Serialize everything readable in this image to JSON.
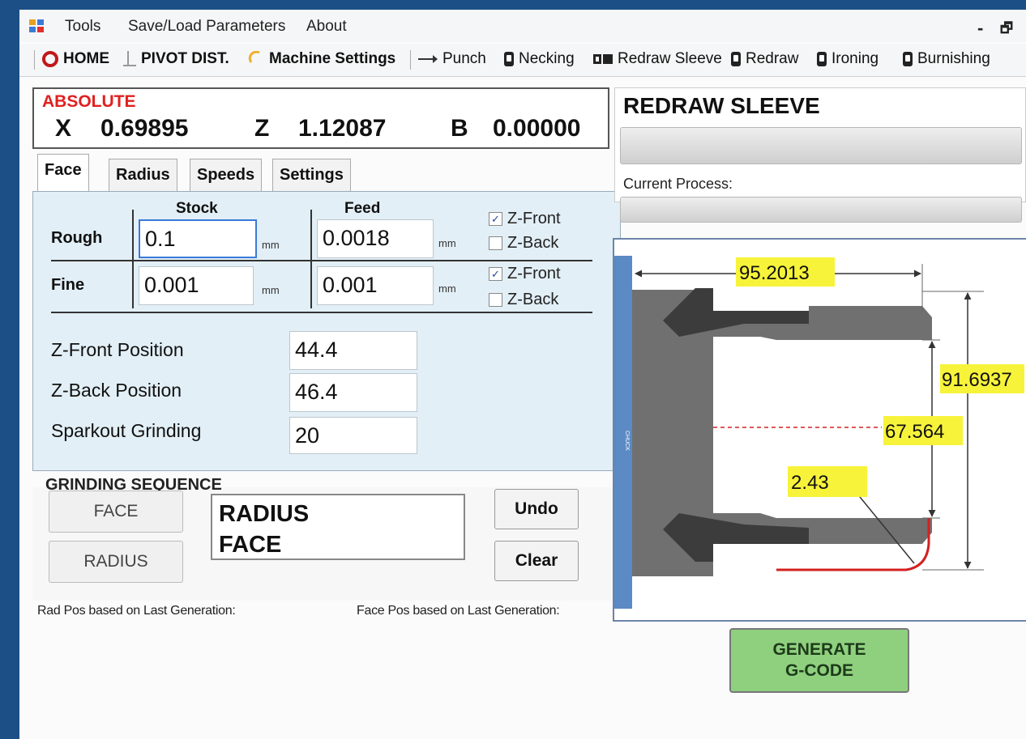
{
  "menu": {
    "items": [
      "Tools",
      "Save/Load Parameters",
      "About"
    ],
    "minimize": "-",
    "restore": "🗗"
  },
  "toolbar": {
    "home": "HOME",
    "pivot": "PIVOT DIST.",
    "machine": "Machine Settings",
    "punch": "Punch",
    "necking": "Necking",
    "redraw_sleeve": "Redraw Sleeve",
    "redraw": "Redraw",
    "ironing": "Ironing",
    "burnishing": "Burnishing"
  },
  "position": {
    "label": "ABSOLUTE",
    "x_label": "X",
    "x_value": "0.69895",
    "z_label": "Z",
    "z_value": "1.12087",
    "b_label": "B",
    "b_value": "0.00000"
  },
  "tabs": [
    "Face",
    "Radius",
    "Speeds",
    "Settings"
  ],
  "face": {
    "stock_header": "Stock",
    "feed_header": "Feed",
    "rough_label": "Rough",
    "fine_label": "Fine",
    "rough_stock": "0.1",
    "rough_feed": "0.0018",
    "fine_stock": "0.001",
    "fine_feed": "0.001",
    "unit": "mm",
    "zfront_label": "Z-Front",
    "zback_label": "Z-Back",
    "rough_zfront_checked": true,
    "rough_zback_checked": false,
    "fine_zfront_checked": true,
    "fine_zback_checked": false,
    "zfront_pos_label": "Z-Front Position",
    "zfront_pos": "44.4",
    "zback_pos_label": "Z-Back Position",
    "zback_pos": "46.4",
    "sparkout_label": "Sparkout Grinding",
    "sparkout": "20"
  },
  "sequence": {
    "title": "GRINDING SEQUENCE",
    "face_btn": "FACE",
    "radius_btn": "RADIUS",
    "list": [
      "RADIUS",
      "FACE"
    ],
    "undo": "Undo",
    "clear": "Clear"
  },
  "notes": {
    "rad": "Rad Pos based on Last Generation:",
    "face": "Face Pos based on Last Generation:"
  },
  "process": {
    "title": "REDRAW SLEEVE",
    "current_label": "Current Process:"
  },
  "drawing": {
    "dim_width": "95.2013",
    "dim_outer": "91.6937",
    "dim_inner": "67.564",
    "dim_radius": "2.43",
    "chuck_label": "CHUCK",
    "colors": {
      "part": "#707070",
      "part_dark": "#3c3c3c",
      "chuck": "#5b8ac4",
      "label_bg": "#f7f33a",
      "edge": "#d42020"
    }
  },
  "generate": {
    "line1": "GENERATE",
    "line2": "G-CODE"
  }
}
